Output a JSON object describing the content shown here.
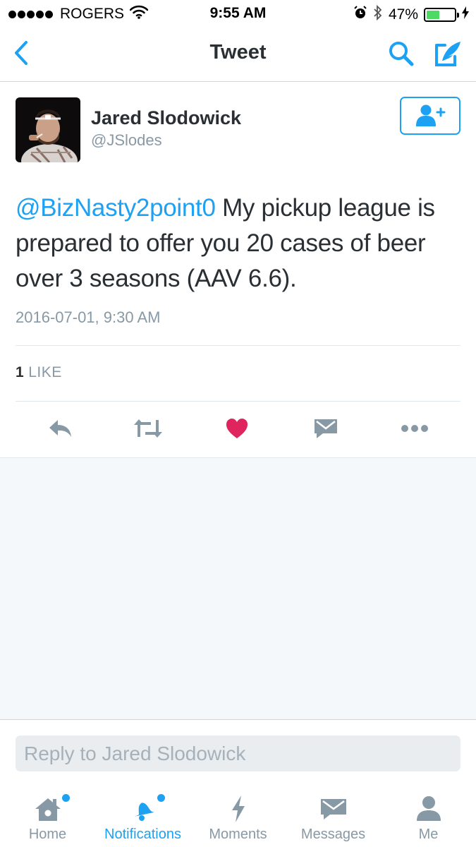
{
  "status_bar": {
    "carrier": "ROGERS",
    "time": "9:55 AM",
    "battery": "47%",
    "battery_level": 0.47,
    "battery_color": "#4cd964"
  },
  "nav": {
    "title": "Tweet",
    "back_icon": "chevron-left-icon",
    "search_icon": "search-icon",
    "compose_icon": "compose-icon"
  },
  "tweet": {
    "author_name": "Jared Slodowick",
    "author_handle": "@JSlodes",
    "mention": "@BizNasty2point0",
    "text": " My pickup league is prepared to offer you 20 cases of beer over 3 seasons (AAV 6.6).",
    "timestamp": "2016-07-01, 9:30 AM",
    "like_count": "1",
    "like_label": "LIKE"
  },
  "actions": [
    "reply-icon",
    "retweet-icon",
    "heart-icon",
    "message-icon",
    "more-icon"
  ],
  "reply": {
    "placeholder": "Reply to Jared Slodowick"
  },
  "tabs": [
    {
      "label": "Home",
      "icon": "home-icon",
      "active": false,
      "has_dot": true
    },
    {
      "label": "Notifications",
      "icon": "bell-icon",
      "active": true,
      "has_dot": true
    },
    {
      "label": "Moments",
      "icon": "lightning-icon",
      "active": false,
      "has_dot": false
    },
    {
      "label": "Messages",
      "icon": "envelope-icon",
      "active": false,
      "has_dot": false
    },
    {
      "label": "Me",
      "icon": "person-icon",
      "active": false,
      "has_dot": false
    }
  ],
  "colors": {
    "accent": "#1da1f2",
    "text": "#292f33",
    "muted": "#8899a6",
    "like": "#e0245e",
    "background": "#f5f8fa"
  }
}
